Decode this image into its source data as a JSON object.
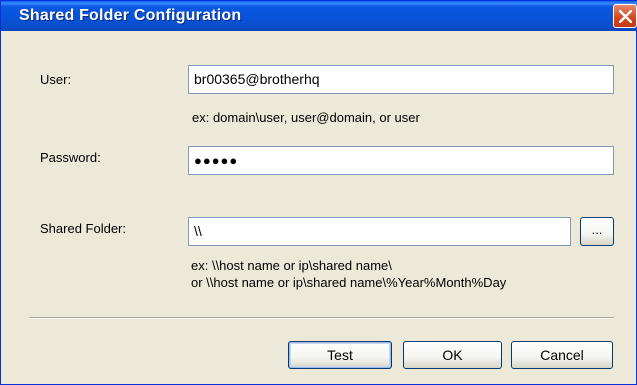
{
  "window": {
    "title": "Shared Folder Configuration",
    "close_label": "close",
    "accent": "#0a52dc"
  },
  "user": {
    "label": "User:",
    "value": "br00365@brotherhq",
    "hint": "ex: domain\\user, user@domain, or user"
  },
  "password": {
    "label": "Password:",
    "masked_value": "●●●●●"
  },
  "shared_folder": {
    "label": "Shared Folder:",
    "value": "\\\\",
    "browse_label": "...",
    "hint_line1": "ex: \\\\host name or ip\\shared name\\",
    "hint_line2": "or \\\\host name or ip\\shared name\\%Year%Month%Day"
  },
  "buttons": {
    "test": "Test",
    "ok": "OK",
    "cancel": "Cancel"
  }
}
